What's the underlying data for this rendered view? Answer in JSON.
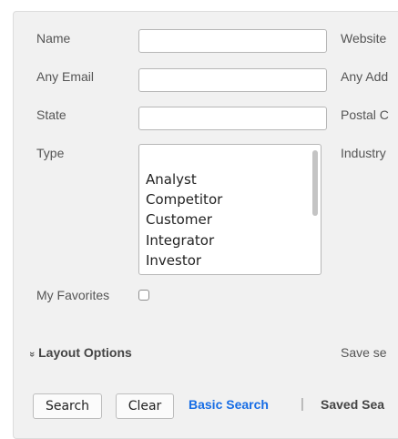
{
  "fields": {
    "name_label": "Name",
    "website_label": "Website",
    "any_email_label": "Any Email",
    "any_address_label": "Any Add",
    "state_label": "State",
    "postal_label": "Postal C",
    "type_label": "Type",
    "industry_label": "Industry",
    "name_value": "",
    "any_email_value": "",
    "state_value": ""
  },
  "type_options": [
    "",
    "Analyst",
    "Competitor",
    "Customer",
    "Integrator",
    "Investor"
  ],
  "favorites": {
    "label": "My Favorites",
    "checked": false
  },
  "layout_options": {
    "icon": "chevron-double-down-icon",
    "label": "Layout Options",
    "save_label": "Save se"
  },
  "actions": {
    "search_label": "Search",
    "clear_label": "Clear",
    "basic_search_label": "Basic Search",
    "separator": "|",
    "saved_search_label": "Saved Sea"
  },
  "colors": {
    "panel_bg": "#f1f1f1",
    "link_blue": "#176de5",
    "label_text": "#555555"
  }
}
